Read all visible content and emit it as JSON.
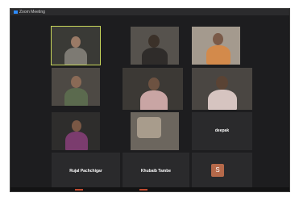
{
  "window": {
    "title": "Zoom Meeting"
  },
  "participants": [
    {
      "id": "p1",
      "label": "",
      "video": true,
      "active": true
    },
    {
      "id": "p2",
      "label": "",
      "video": true
    },
    {
      "id": "p3",
      "label": "",
      "video": true
    },
    {
      "id": "p4",
      "label": "",
      "video": true
    },
    {
      "id": "p5",
      "label": "",
      "video": true
    },
    {
      "id": "p6",
      "label": "",
      "video": true
    },
    {
      "id": "p7",
      "label": "",
      "video": true
    },
    {
      "id": "p8",
      "label": "",
      "video": true
    },
    {
      "id": "p9",
      "name": "deepak",
      "video": false
    },
    {
      "id": "p10",
      "name": "Rujal Pachchigar",
      "video": false
    },
    {
      "id": "p11",
      "name": "Khubaib Tambe",
      "video": false
    },
    {
      "id": "p12",
      "initial": "S",
      "video": false
    }
  ],
  "colors": {
    "active_speaker_border": "#c8d65b",
    "initial_avatar": "#b5694a"
  }
}
